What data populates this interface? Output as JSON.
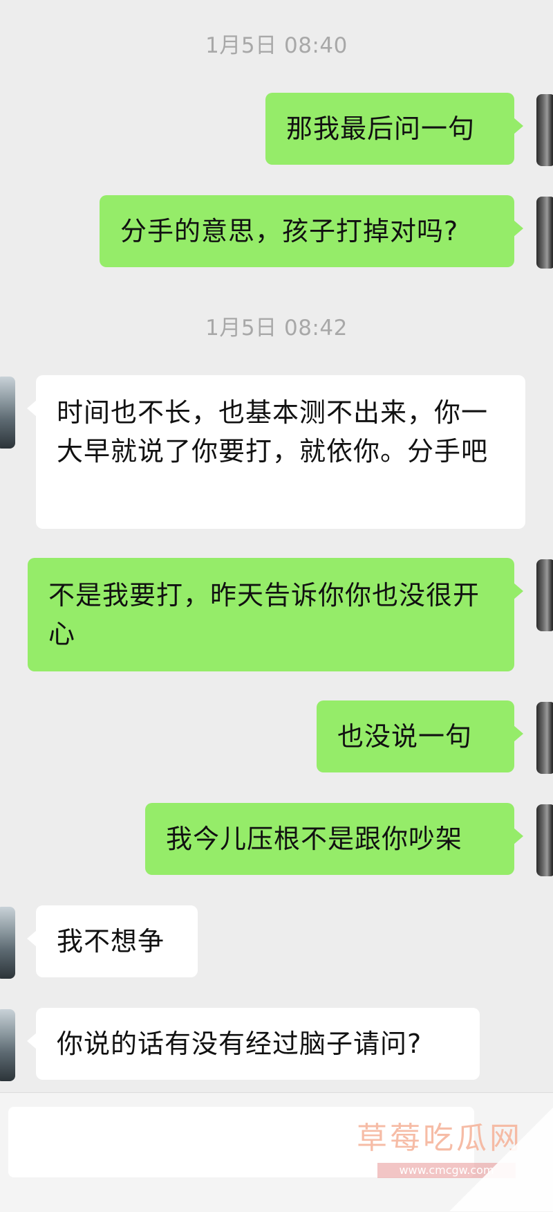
{
  "timestamps": [
    "1月5日 08:40",
    "1月5日 08:42"
  ],
  "messages": [
    {
      "side": "me",
      "text": "那我最后问一句"
    },
    {
      "side": "me",
      "text": "分手的意思，孩子打掉对吗?"
    },
    {
      "side": "them",
      "text": "时间也不长，也基本测不出来，你一大早就说了你要打，就依你。分手吧"
    },
    {
      "side": "me",
      "text": "不是我要打，昨天告诉你你也没很开心"
    },
    {
      "side": "me",
      "text": "也没说一句"
    },
    {
      "side": "me",
      "text": "我今儿压根不是跟你吵架"
    },
    {
      "side": "them",
      "text": "我不想争"
    },
    {
      "side": "them",
      "text": "你说的话有没有经过脑子请问?"
    }
  ],
  "input": {
    "value": "",
    "placeholder": ""
  },
  "watermark": {
    "title": "草莓吃瓜网",
    "url": "www.cmcgw.com"
  },
  "colors": {
    "background": "#ededed",
    "my_bubble": "#95ec69",
    "their_bubble": "#ffffff",
    "timestamp": "#a8a8a8"
  }
}
